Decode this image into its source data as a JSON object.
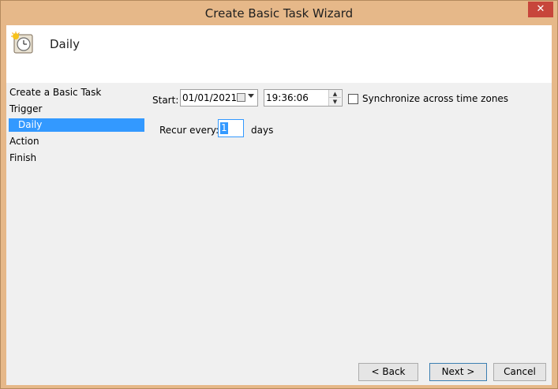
{
  "window": {
    "title": "Create Basic Task Wizard",
    "close_label": "✕"
  },
  "header": {
    "title": "Daily",
    "icon": "task-scheduler-clock-icon"
  },
  "nav": {
    "items": [
      {
        "label": "Create a Basic Task",
        "selected": false
      },
      {
        "label": "Trigger",
        "selected": false
      },
      {
        "label": "Daily",
        "selected": true
      },
      {
        "label": "Action",
        "selected": false
      },
      {
        "label": "Finish",
        "selected": false
      }
    ]
  },
  "form": {
    "start_label": "Start:",
    "start_date": "01/01/2021",
    "start_time": "19:36:06",
    "sync_label": "Synchronize across time zones",
    "sync_checked": false,
    "recur_label": "Recur every:",
    "recur_value": "1",
    "recur_unit": "days"
  },
  "buttons": {
    "back": "< Back",
    "next": "Next >",
    "cancel": "Cancel"
  },
  "colors": {
    "frame": "#e6b889",
    "selection": "#3399ff",
    "close": "#c7463b"
  }
}
